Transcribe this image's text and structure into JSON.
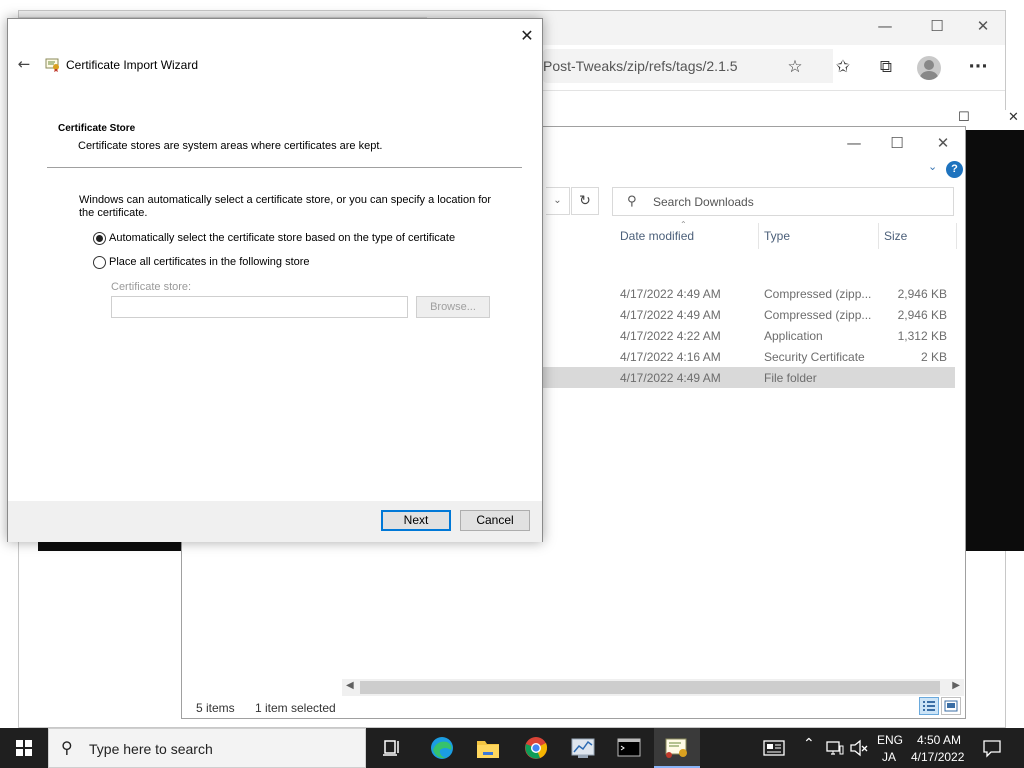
{
  "browser": {
    "address_text": "Post-Tweaks/zip/refs/tags/2.1.5",
    "minimize_glyph": "—",
    "maximize_glyph": "☐",
    "close_glyph": "✕",
    "favorite_add_glyph": "☆",
    "favorites_glyph": "✩",
    "collections_glyph": "⧉",
    "more_glyph": "···"
  },
  "console": {
    "maximize_glyph": "☐",
    "close_glyph": "✕"
  },
  "explorer": {
    "minimize_glyph": "—",
    "maximize_glyph": "☐",
    "close_glyph": "✕",
    "help_glyph": "?",
    "expand_glyph": "⌄",
    "dropdown_glyph": "⌄",
    "refresh_glyph": "↻",
    "search_placeholder": "Search Downloads",
    "columns": {
      "date_modified": "Date modified",
      "type": "Type",
      "size": "Size"
    },
    "rows": [
      {
        "date": "4/17/2022 4:49 AM",
        "type": "Compressed (zipp...",
        "size": "2,946 KB"
      },
      {
        "date": "4/17/2022 4:49 AM",
        "type": "Compressed (zipp...",
        "size": "2,946 KB"
      },
      {
        "date": "4/17/2022 4:22 AM",
        "type": "Application",
        "size": "1,312 KB"
      },
      {
        "date": "4/17/2022 4:16 AM",
        "type": "Security Certificate",
        "size": "2 KB"
      },
      {
        "date": "4/17/2022 4:49 AM",
        "type": "File folder",
        "size": ""
      }
    ],
    "status_items": "5 items",
    "status_selected": "1 item selected"
  },
  "dialog": {
    "title": "Certificate Import Wizard",
    "close_glyph": "✕",
    "back_glyph": "←",
    "header_title": "Certificate Store",
    "header_desc": "Certificate stores are system areas where certificates are kept.",
    "body_text": "Windows can automatically select a certificate store, or you can specify a location for the certificate.",
    "option_auto": "Automatically select the certificate store based on the type of certificate",
    "option_manual": "Place all certificates in the following store",
    "store_label": "Certificate store:",
    "store_value": "",
    "browse_label": "Browse...",
    "next_label": "Next",
    "cancel_label": "Cancel"
  },
  "taskbar": {
    "search_placeholder": "Type here to search",
    "language_top": "ENG",
    "language_bottom": "JA",
    "time": "4:50 AM",
    "date": "4/17/2022",
    "apps": [
      "task-view",
      "edge",
      "file-explorer",
      "chrome",
      "server-manager",
      "command-prompt",
      "certificate-manager"
    ]
  },
  "colors": {
    "accent": "#0078d7",
    "taskbar": "#1f1f1f",
    "selection": "#d9d9d9"
  }
}
